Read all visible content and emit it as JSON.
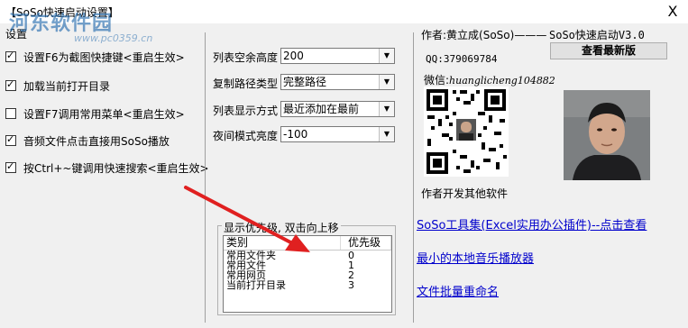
{
  "window": {
    "title": "【SoSo快速启动设置】",
    "close_label": "X"
  },
  "watermark": {
    "text": "河东软件园",
    "url": "www.pc0359.cn"
  },
  "settings": {
    "group_label": "设置",
    "checkboxes": [
      {
        "label": "设置F6为截图快捷键<重启生效>",
        "checked": true
      },
      {
        "label": "加载当前打开目录",
        "checked": true
      },
      {
        "label": "设置F7调用常用菜单<重启生效>",
        "checked": false
      },
      {
        "label": "音频文件点击直接用SoSo播放",
        "checked": true
      },
      {
        "label": "按Ctrl+~键调用快速搜索<重启生效>",
        "checked": true
      }
    ]
  },
  "options": {
    "list_height_label": "列表空余高度",
    "list_height_value": "200",
    "copy_path_label": "复制路径类型",
    "copy_path_value": "完整路径",
    "display_mode_label": "列表显示方式",
    "display_mode_value": "最近添加在最前",
    "night_mode_label": "夜间模式亮度",
    "night_mode_value": "-100"
  },
  "priority": {
    "caption": "显示优先级, 双击向上移",
    "col_category": "类别",
    "col_priority": "优先级",
    "rows": [
      {
        "category": "常用文件夹",
        "priority": "0"
      },
      {
        "category": "常用文件",
        "priority": "1"
      },
      {
        "category": "常用网页",
        "priority": "2"
      },
      {
        "category": "当前打开目录",
        "priority": "3"
      }
    ]
  },
  "author": {
    "label": "作者:黄立成(SoSo)———",
    "version": "SoSo快速启动V3.0",
    "check_button": "查看最新版",
    "qq": "QQ:379069784",
    "wechat_prefix": "微信:",
    "wechat_id": "huanglicheng104882",
    "other_software": "作者开发其他软件"
  },
  "links": [
    "SoSo工具集(Excel实用办公插件)--点击查看",
    "最小的本地音乐播放器",
    "文件批量重命名"
  ],
  "colors": {
    "link": "#0000cc",
    "arrow": "#e02020",
    "watermark": "#2a6fb0"
  }
}
